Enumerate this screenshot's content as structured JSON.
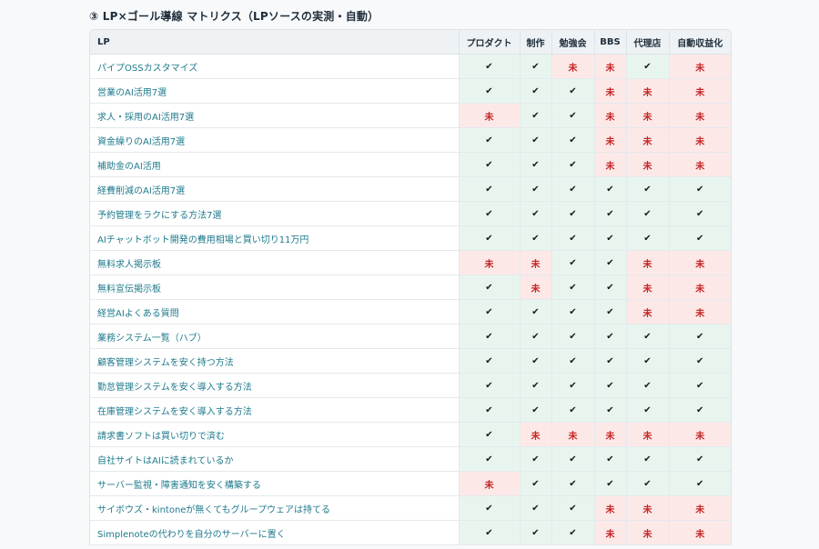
{
  "section_title": "③ LP×ゴール導線 マトリクス（LPソースの実測・自動）",
  "legend": {
    "done": "✔",
    "todo": "未"
  },
  "columns": [
    "LP",
    "プロダクト",
    "制作",
    "勉強会",
    "BBS",
    "代理店",
    "自動収益化"
  ],
  "rows": [
    {
      "lp": "パイプOSSカスタマイズ",
      "status": [
        "done",
        "done",
        "todo",
        "todo",
        "done",
        "todo"
      ]
    },
    {
      "lp": "営業のAI活用7選",
      "status": [
        "done",
        "done",
        "done",
        "todo",
        "todo",
        "todo"
      ]
    },
    {
      "lp": "求人・採用のAI活用7選",
      "status": [
        "todo",
        "done",
        "done",
        "todo",
        "todo",
        "todo"
      ]
    },
    {
      "lp": "資金繰りのAI活用7選",
      "status": [
        "done",
        "done",
        "done",
        "todo",
        "todo",
        "todo"
      ]
    },
    {
      "lp": "補助金のAI活用",
      "status": [
        "done",
        "done",
        "done",
        "todo",
        "todo",
        "todo"
      ]
    },
    {
      "lp": "経費削減のAI活用7選",
      "status": [
        "done",
        "done",
        "done",
        "done",
        "done",
        "done"
      ]
    },
    {
      "lp": "予約管理をラクにする方法7選",
      "status": [
        "done",
        "done",
        "done",
        "done",
        "done",
        "done"
      ]
    },
    {
      "lp": "AIチャットボット開発の費用相場と買い切り11万円",
      "status": [
        "done",
        "done",
        "done",
        "done",
        "done",
        "done"
      ]
    },
    {
      "lp": "無料求人掲示板",
      "status": [
        "todo",
        "todo",
        "done",
        "done",
        "todo",
        "todo"
      ]
    },
    {
      "lp": "無料宣伝掲示板",
      "status": [
        "done",
        "todo",
        "done",
        "done",
        "todo",
        "todo"
      ]
    },
    {
      "lp": "経営AIよくある質問",
      "status": [
        "done",
        "done",
        "done",
        "done",
        "todo",
        "todo"
      ]
    },
    {
      "lp": "業務システム一覧（ハブ）",
      "status": [
        "done",
        "done",
        "done",
        "done",
        "done",
        "done"
      ]
    },
    {
      "lp": "顧客管理システムを安く持つ方法",
      "status": [
        "done",
        "done",
        "done",
        "done",
        "done",
        "done"
      ]
    },
    {
      "lp": "勤怠管理システムを安く導入する方法",
      "status": [
        "done",
        "done",
        "done",
        "done",
        "done",
        "done"
      ]
    },
    {
      "lp": "在庫管理システムを安く導入する方法",
      "status": [
        "done",
        "done",
        "done",
        "done",
        "done",
        "done"
      ]
    },
    {
      "lp": "請求書ソフトは買い切りで済む",
      "status": [
        "done",
        "todo",
        "todo",
        "todo",
        "todo",
        "todo"
      ]
    },
    {
      "lp": "自社サイトはAIに読まれているか",
      "status": [
        "done",
        "done",
        "done",
        "done",
        "done",
        "done"
      ]
    },
    {
      "lp": "サーバー監視・障害通知を安く構築する",
      "status": [
        "todo",
        "done",
        "done",
        "done",
        "done",
        "done"
      ]
    },
    {
      "lp": "サイボウズ・kintoneが無くてもグループウェアは持てる",
      "status": [
        "done",
        "done",
        "done",
        "todo",
        "todo",
        "todo"
      ]
    },
    {
      "lp": "Simplenoteの代わりを自分のサーバーに置く",
      "status": [
        "done",
        "done",
        "done",
        "todo",
        "todo",
        "todo"
      ]
    }
  ]
}
